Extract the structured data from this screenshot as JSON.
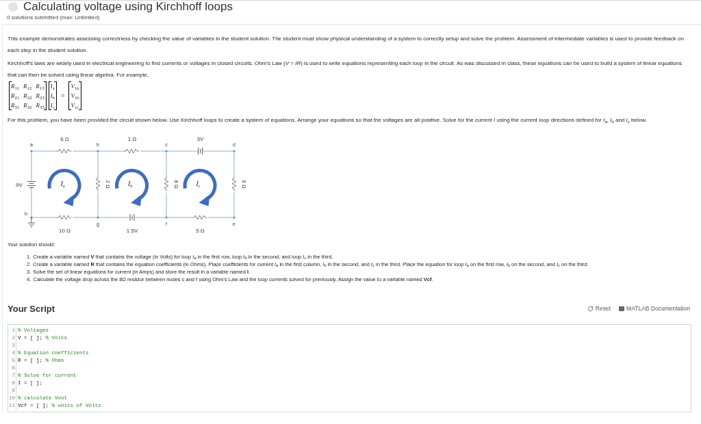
{
  "header": {
    "title": "Calculating voltage using Kirchhoff loops",
    "subtitle": "0 solutions submitted (max: Unlimited)"
  },
  "intro": [
    "This example demonstrates assessing correctness by checking the value of variables in the student solution. The student must show physical understanding of a system to correctly setup and solve the problem. Assessment of intermediate variables is used to provide feedback on each step in the student solution.",
    "Kirchhoff's laws are widely used in electrical engineering to find currents or voltages in closed circuits. Ohm's Law (*V* = *IR*) is used to write equations representing each loop in the circuit. As was discussed in class, these equations can be used to build a system of linear equations that can then be solved using linear algebra. For example,"
  ],
  "matrix": {
    "coefficients": [
      [
        "*R*$_{11}$",
        "*R*$_{12}$",
        "*R*$_{13}$"
      ],
      [
        "*R*$_{21}$",
        "*R*$_{22}$",
        "*R*$_{23}$"
      ],
      [
        "*R*$_{31}$",
        "*R*$_{32}$",
        "*R*$_{33}$"
      ]
    ],
    "unknowns": [
      "*I*$_{a}$",
      "*I*$_{b}$",
      "*I*$_{c}$"
    ],
    "equals": "=",
    "constants": [
      "*V*$_{1a}$",
      "*V*$_{1b}$",
      "*V*$_{1c}$"
    ]
  },
  "problem": "For this problem, you have been provided the circuit shown below. Use Kirchhoff loops to create a system of equations. Arrange your equations so that the voltages are all positive. Solve for the current *I* using the current loop directions defined for *I*$_{a}$, *I*$_{b}$ and *I*$_{c}$ below.",
  "circuit": {
    "nodes": [
      "a",
      "b",
      "c",
      "d",
      "h",
      "g",
      "f",
      "e"
    ],
    "top_labels": [
      "6 Ω",
      "1 Ω",
      "3V"
    ],
    "bottom_labels": [
      "10 Ω",
      "1.5V",
      "5 Ω"
    ],
    "side_labels": [
      "9V",
      "2 Ω",
      "8 Ω",
      "9 Ω"
    ],
    "loops": [
      {
        "label": "I",
        "sub": "a"
      },
      {
        "label": "I",
        "sub": "b"
      },
      {
        "label": "I",
        "sub": "c"
      }
    ]
  },
  "solution_heading": "Your solution should:",
  "tasks": [
    {
      "marker": "1.",
      "text": "Create a variable named **V** that contains the voltage (in Volts) for loop *I*$_{a}$ in the first row, loop *I*$_{b}$ in the second, and loop *I*$_{c}$ in the third."
    },
    {
      "marker": "2.",
      "text": "Create a variable named **R** that contains the equation coefficients (in Ohms). Place coefficients for current *I*$_{a}$ in the first column, *I*$_{b}$ in the second, and *I*$_{c}$ in the third. Place the equation for loop *I*$_{a}$ on the first row, *I*$_{b}$ on the second, and *I*$_{c}$ on the third."
    },
    {
      "marker": "3.",
      "text": "Solve the set of linear equations for current (in Amps) and store the result in a variable named **I**."
    },
    {
      "marker": "4.",
      "text": "Calculate the voltage drop across the 8Ω resistor between nodes c and f using Ohm's Law and the loop currents solved for previously. Assign the value to a variable named **Vcf**."
    }
  ],
  "script": {
    "title": "Your Script",
    "reset": "Reset",
    "docs": "MATLAB Documentation",
    "lines": [
      {
        "number": "1",
        "comment": "% Voltages"
      },
      {
        "number": "2",
        "code": "V = [ ]; ",
        "comment": "% Volts"
      },
      {
        "number": "3"
      },
      {
        "number": "4",
        "comment": "% Equation coefficients"
      },
      {
        "number": "5",
        "code": "R = [ ]; ",
        "comment": "% Ohms"
      },
      {
        "number": "6"
      },
      {
        "number": "7",
        "comment": "% Solve for current"
      },
      {
        "number": "8",
        "code": "I = [ ];"
      },
      {
        "number": "9"
      },
      {
        "number": "10",
        "comment": "% calculate Vout"
      },
      {
        "number": "11",
        "code": "Vcf = [ ]; ",
        "comment": "% units of Volts"
      }
    ]
  }
}
